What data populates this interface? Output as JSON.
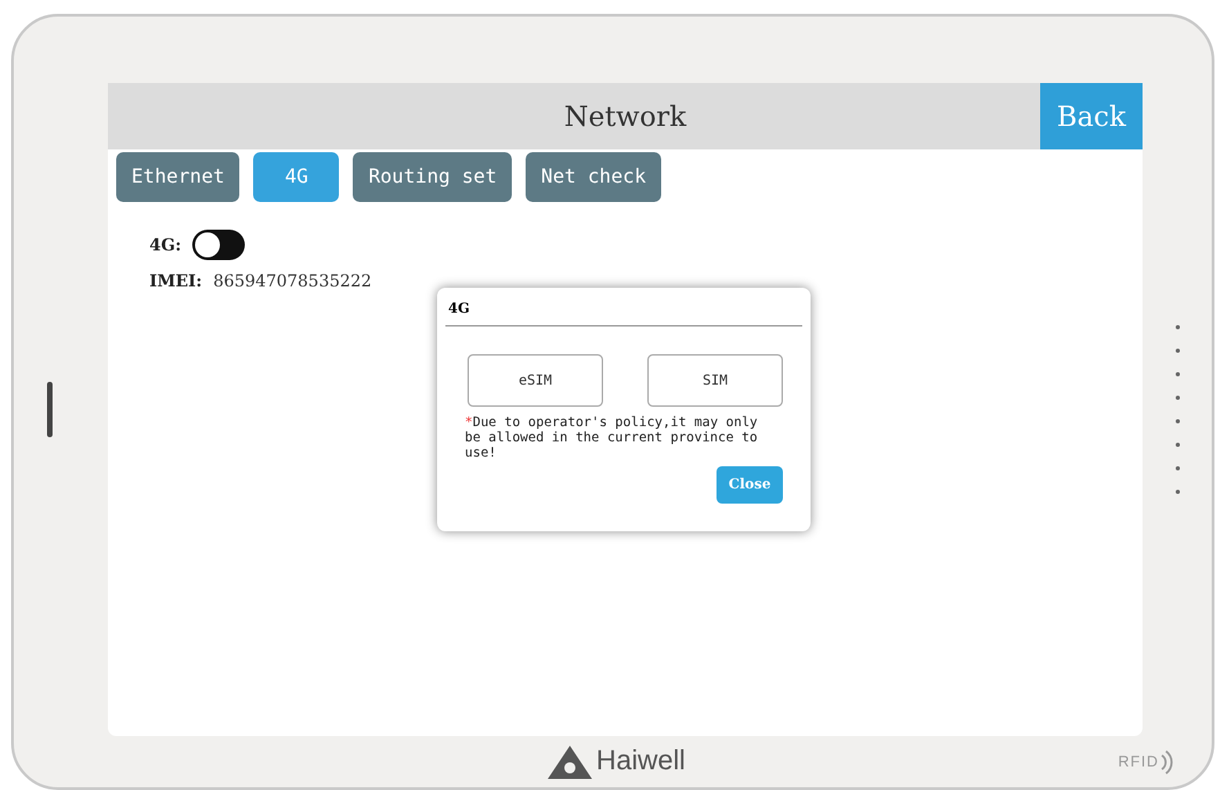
{
  "header": {
    "title": "Network",
    "back": "Back"
  },
  "tabs": [
    {
      "label": "Ethernet",
      "selected": false
    },
    {
      "label": "4G",
      "selected": true
    },
    {
      "label": "Routing set",
      "selected": false
    },
    {
      "label": "Net check",
      "selected": false
    }
  ],
  "switch": {
    "label": "4G:",
    "on": false
  },
  "imei": {
    "label": "IMEI:",
    "value": "865947078535222"
  },
  "dialog": {
    "title": "4G",
    "options": [
      "eSIM",
      "SIM"
    ],
    "note_mark": "*",
    "note": "Due to operator's policy,it may only be allowed in the current province to use!",
    "close": "Close"
  },
  "bezel": {
    "brand": "Haiwell",
    "rfid": "RFID"
  }
}
